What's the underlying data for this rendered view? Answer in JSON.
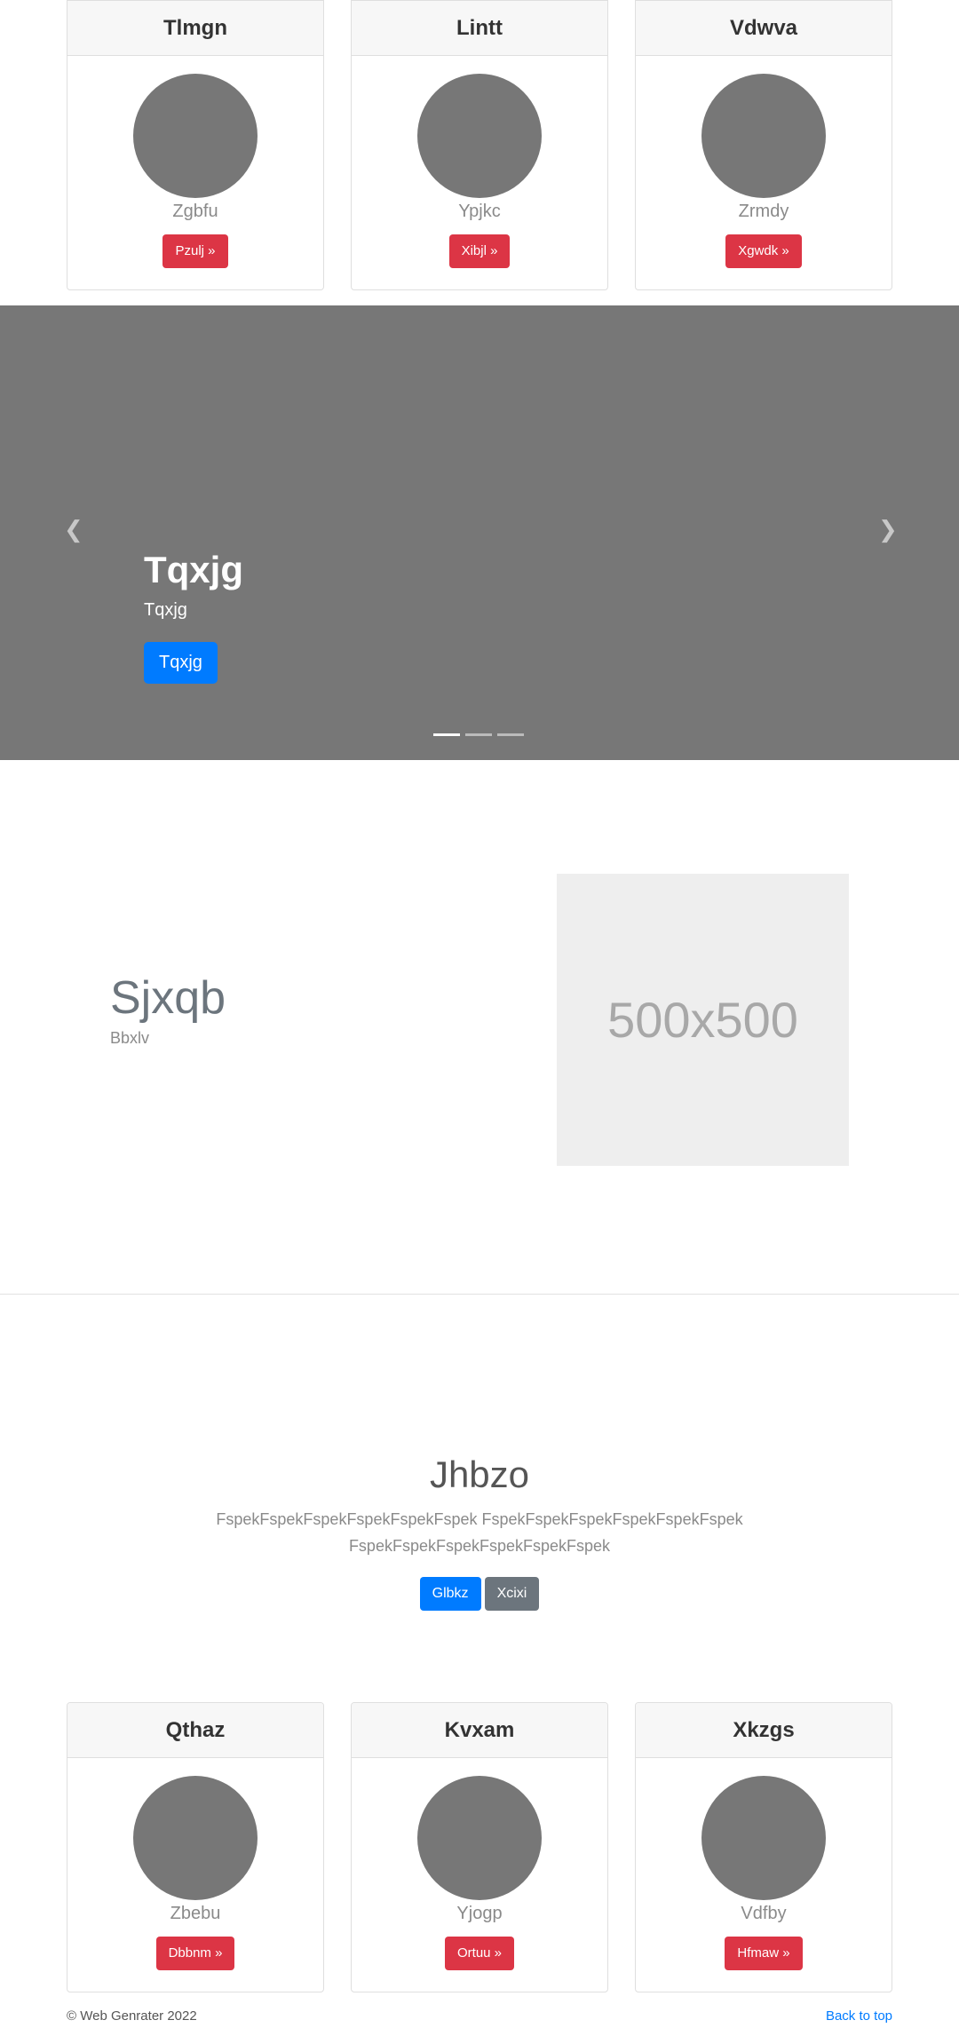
{
  "top_cards": [
    {
      "title": "Tlmgn",
      "subtitle": "Zgbfu",
      "button": "Pzulj »"
    },
    {
      "title": "Lintt",
      "subtitle": "Ypjkc",
      "button": "Xibjl »"
    },
    {
      "title": "Vdwva",
      "subtitle": "Zrmdy",
      "button": "Xgwdk »"
    }
  ],
  "carousel": {
    "title": "Tqxjg",
    "text": "Tqxjg",
    "button": "Tqxjg",
    "prev_icon": "chevron-left-icon",
    "next_icon": "chevron-right-icon",
    "slide_count": 3,
    "active_slide": 1,
    "background_color": "#777777"
  },
  "feature": {
    "title": "Sjxqb",
    "subtitle": "Bbxlv",
    "placeholder_label": "500x500"
  },
  "hero": {
    "title": "Jhbzo",
    "text": "FspekFspekFspekFspekFspekFspek FspekFspekFspekFspekFspekFspek FspekFspekFspekFspekFspekFspek",
    "primary_button": "Glbkz",
    "secondary_button": "Xcixi"
  },
  "bottom_cards": [
    {
      "title": "Qthaz",
      "subtitle": "Zbebu",
      "button": "Dbbnm »"
    },
    {
      "title": "Kvxam",
      "subtitle": "Yjogp",
      "button": "Ortuu »"
    },
    {
      "title": "Xkzgs",
      "subtitle": "Vdfby",
      "button": "Hfmaw »"
    }
  ],
  "footer": {
    "copyright": "© Web Genrater 2022",
    "back_to_top": "Back to top"
  },
  "colors": {
    "primary": "#007bff",
    "danger": "#dc3545",
    "secondary": "#6c757d"
  }
}
